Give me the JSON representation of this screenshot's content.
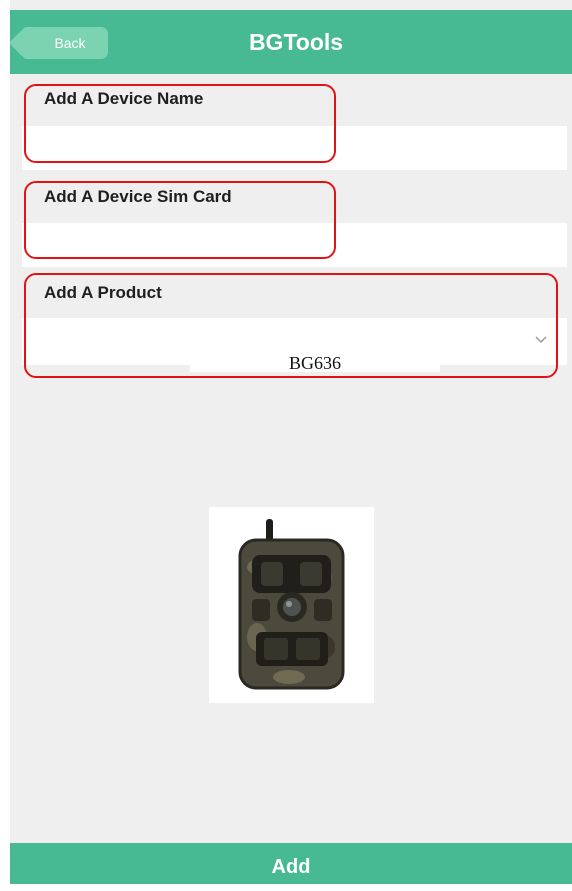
{
  "header": {
    "back_label": "Back",
    "title": "BGTools"
  },
  "form": {
    "device_name": {
      "label": "Add A Device Name",
      "value": ""
    },
    "sim_card": {
      "label": "Add A Device Sim Card",
      "value": ""
    },
    "product": {
      "label": "Add A Product",
      "selected": "BG636"
    }
  },
  "footer": {
    "add_label": "Add"
  },
  "colors": {
    "accent": "#47b993",
    "back_button": "#7bd3b2",
    "highlight": "#e01414",
    "background": "#efefef"
  },
  "icons": {
    "select": "chevron-down-icon"
  }
}
